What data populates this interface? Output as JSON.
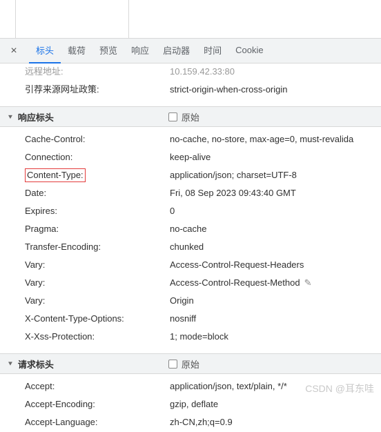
{
  "tabs": [
    "标头",
    "载荷",
    "预览",
    "响应",
    "启动器",
    "时间",
    "Cookie"
  ],
  "active_tab_index": 0,
  "general": {
    "remote_addr_label": "远程地址:",
    "remote_addr_value": "10.159.42.33:80",
    "referrer_policy_label": "引荐来源网址政策:",
    "referrer_policy_value": "strict-origin-when-cross-origin"
  },
  "section_response": {
    "title": "响应标头",
    "raw_label": "原始"
  },
  "response_headers": [
    {
      "key": "Cache-Control:",
      "val": "no-cache, no-store, max-age=0, must-revalida"
    },
    {
      "key": "Connection:",
      "val": "keep-alive"
    },
    {
      "key": "Content-Type:",
      "val": "application/json; charset=UTF-8",
      "highlight": true
    },
    {
      "key": "Date:",
      "val": "Fri, 08 Sep 2023 09:43:40 GMT"
    },
    {
      "key": "Expires:",
      "val": "0"
    },
    {
      "key": "Pragma:",
      "val": "no-cache"
    },
    {
      "key": "Transfer-Encoding:",
      "val": "chunked"
    },
    {
      "key": "Vary:",
      "val": "Access-Control-Request-Headers"
    },
    {
      "key": "Vary:",
      "val": "Access-Control-Request-Method",
      "edit": true
    },
    {
      "key": "Vary:",
      "val": "Origin"
    },
    {
      "key": "X-Content-Type-Options:",
      "val": "nosniff"
    },
    {
      "key": "X-Xss-Protection:",
      "val": "1; mode=block"
    }
  ],
  "section_request": {
    "title": "请求标头",
    "raw_label": "原始"
  },
  "request_headers": [
    {
      "key": "Accept:",
      "val": "application/json, text/plain, */*"
    },
    {
      "key": "Accept-Encoding:",
      "val": "gzip, deflate"
    },
    {
      "key": "Accept-Language:",
      "val": "zh-CN,zh;q=0.9"
    }
  ],
  "watermark": "CSDN @耳东哇"
}
